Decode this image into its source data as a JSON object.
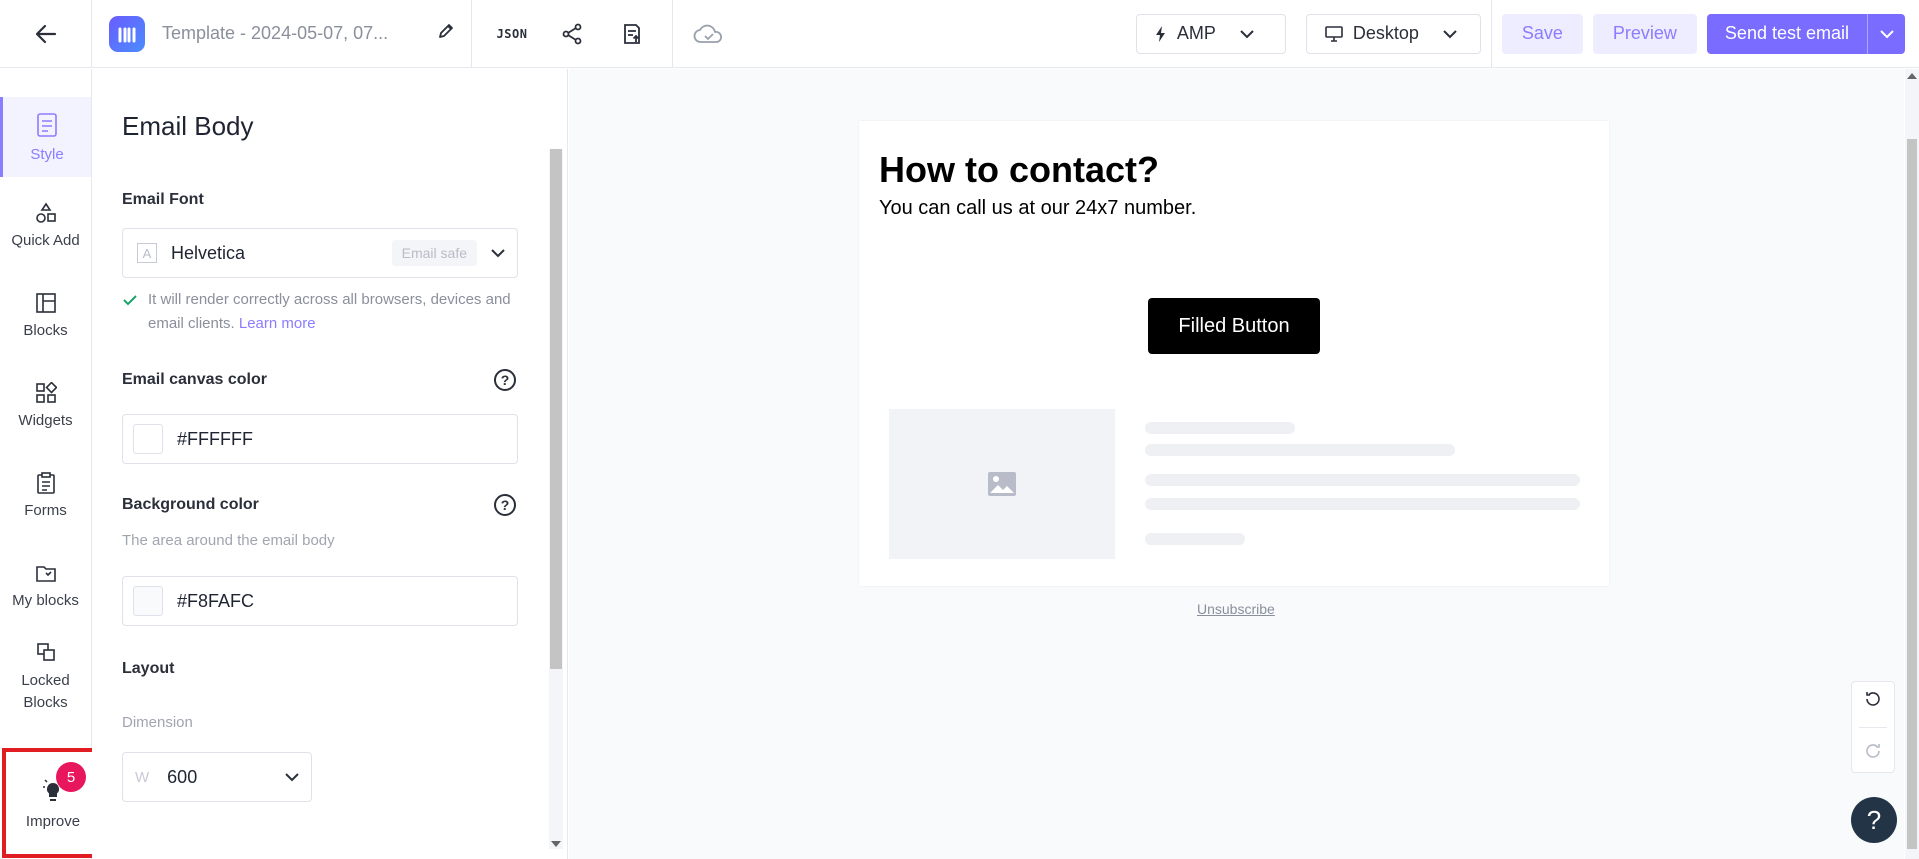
{
  "header": {
    "template_title": "Template - 2024-05-07, 07...",
    "json_label": "JSON",
    "amp_label": "AMP",
    "device_label": "Desktop",
    "save_label": "Save",
    "preview_label": "Preview",
    "send_label": "Send test email"
  },
  "sidebar": {
    "items": [
      {
        "label": "Style",
        "icon": "style-icon"
      },
      {
        "label": "Quick Add",
        "icon": "shapes-icon"
      },
      {
        "label": "Blocks",
        "icon": "layout-icon"
      },
      {
        "label": "Widgets",
        "icon": "widgets-icon"
      },
      {
        "label": "Forms",
        "icon": "clipboard-icon"
      },
      {
        "label": "My blocks",
        "icon": "folder-icon"
      },
      {
        "label": "Locked Blocks",
        "icon": "locked-blocks-icon"
      }
    ],
    "improve": {
      "label": "Improve",
      "badge": "5"
    }
  },
  "panel": {
    "title": "Email Body",
    "email_font_label": "Email Font",
    "email_font_value": "Helvetica",
    "email_safe_tag": "Email safe",
    "font_note": "It will render correctly across all browsers, devices and email clients.",
    "learn_more": "Learn more",
    "canvas_color_label": "Email canvas color",
    "canvas_color_value": "#FFFFFF",
    "bg_color_label": "Background color",
    "bg_color_hint": "The area around the email body",
    "bg_color_value": "#F8FAFC",
    "layout_label": "Layout",
    "dimension_label": "Dimension",
    "width_prefix": "W",
    "width_value": "600"
  },
  "email": {
    "heading": "How to contact?",
    "body": "You can call us at our 24x7 number.",
    "button_label": "Filled Button",
    "unsubscribe": "Unsubscribe"
  },
  "colors": {
    "accent": "#7a6cff",
    "badge": "#e8175d",
    "highlight_border": "#e11d24"
  }
}
